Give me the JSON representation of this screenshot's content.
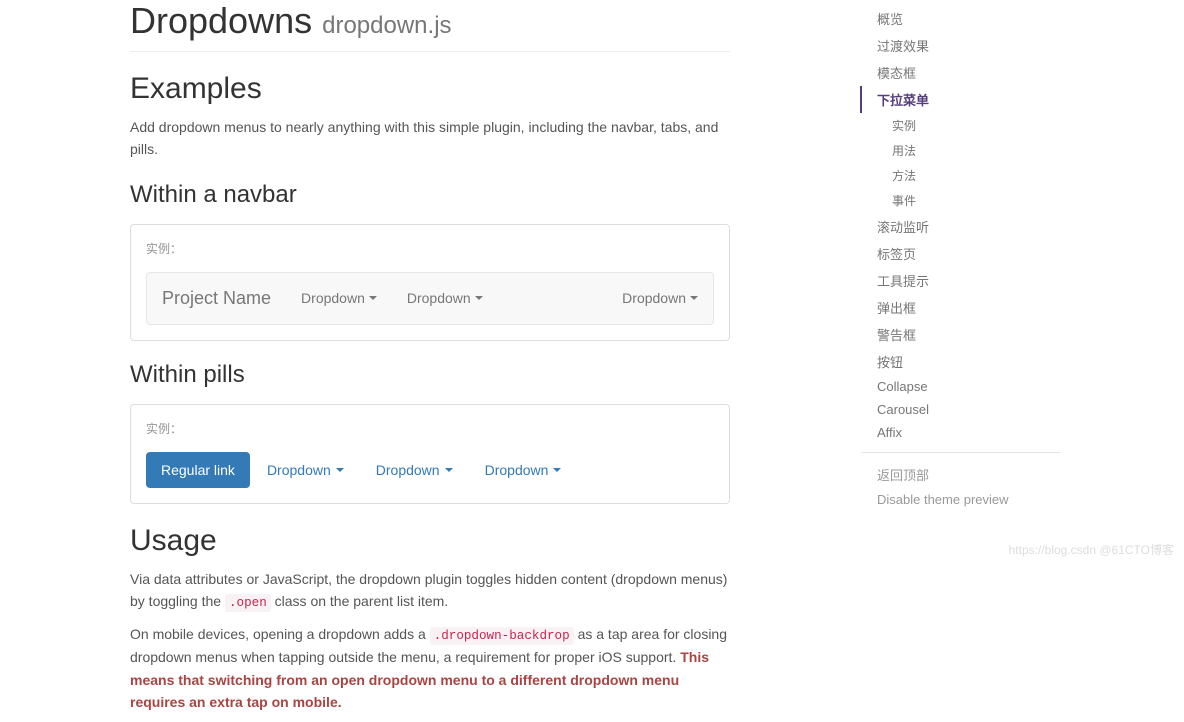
{
  "header": {
    "title": "Dropdowns",
    "subtitle": "dropdown.js"
  },
  "examples": {
    "heading": "Examples",
    "intro": "Add dropdown menus to nearly anything with this simple plugin, including the navbar, tabs, and pills."
  },
  "navbar_example": {
    "heading": "Within a navbar",
    "label": "实例：",
    "brand": "Project Name",
    "items": [
      "Dropdown",
      "Dropdown"
    ],
    "right": "Dropdown"
  },
  "pills_example": {
    "heading": "Within pills",
    "label": "实例：",
    "regular": "Regular link",
    "items": [
      "Dropdown",
      "Dropdown",
      "Dropdown"
    ]
  },
  "usage": {
    "heading": "Usage",
    "para1_a": "Via data attributes or JavaScript, the dropdown plugin toggles hidden content (dropdown menus) by toggling the ",
    "code1": ".open",
    "para1_b": " class on the parent list item.",
    "para2_a": "On mobile devices, opening a dropdown adds a ",
    "code2": ".dropdown-backdrop",
    "para2_b": " as a tap area for closing dropdown menus when tapping outside the menu, a requirement for proper iOS support. ",
    "warn": "This means that switching from an open dropdown menu to a different dropdown menu requires an extra tap on mobile."
  },
  "sidebar": {
    "items": [
      {
        "label": "概览",
        "active": false
      },
      {
        "label": "过渡效果",
        "active": false
      },
      {
        "label": "模态框",
        "active": false
      },
      {
        "label": "下拉菜单",
        "active": true
      },
      {
        "label": "实例",
        "sub": true
      },
      {
        "label": "用法",
        "sub": true
      },
      {
        "label": "方法",
        "sub": true
      },
      {
        "label": "事件",
        "sub": true
      },
      {
        "label": "滚动监听",
        "active": false
      },
      {
        "label": "标签页",
        "active": false
      },
      {
        "label": "工具提示",
        "active": false
      },
      {
        "label": "弹出框",
        "active": false
      },
      {
        "label": "警告框",
        "active": false
      },
      {
        "label": "按钮",
        "active": false
      },
      {
        "label": "Collapse",
        "active": false
      },
      {
        "label": "Carousel",
        "active": false
      },
      {
        "label": "Affix",
        "active": false
      }
    ],
    "back_to_top": "返回顶部",
    "disable_theme": "Disable theme preview"
  },
  "watermark": "https://blog.csdn @61CTO博客"
}
